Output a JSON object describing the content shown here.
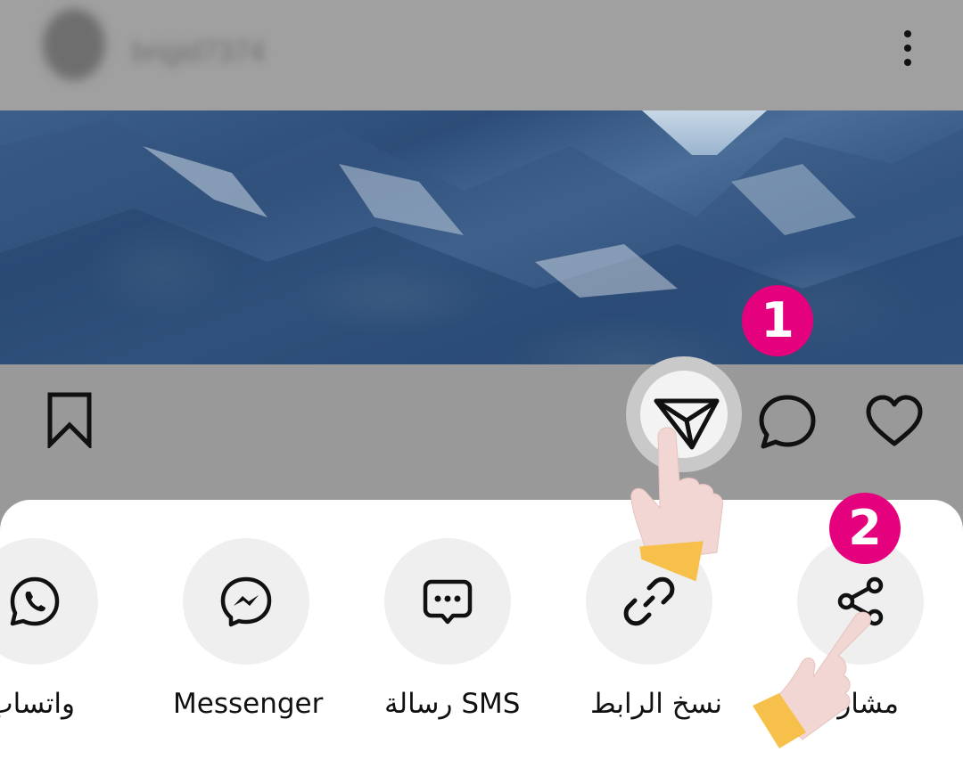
{
  "post_header": {
    "username": "brigid7374"
  },
  "icons": {
    "more": "more-vertical-icon",
    "bookmark": "bookmark-icon",
    "send": "paper-plane-icon",
    "comment": "comment-icon",
    "like": "heart-icon"
  },
  "step_badges": [
    {
      "number": "1"
    },
    {
      "number": "2"
    }
  ],
  "share_sheet": {
    "items": [
      {
        "label": "واتساب",
        "icon": "whatsapp-icon"
      },
      {
        "label": "Messenger",
        "icon": "messenger-icon"
      },
      {
        "label": "رسالة SMS",
        "icon": "sms-icon"
      },
      {
        "label": "نسخ الرابط",
        "icon": "link-icon"
      },
      {
        "label": "مشاركة",
        "icon": "share-icon"
      }
    ]
  },
  "colors": {
    "badge": "#e5007e",
    "dim_overlay": "#999999",
    "sheet": "#ffffff",
    "circle": "#efefef",
    "wristband": "#f7c04a",
    "hand": "#f1d6d3"
  }
}
